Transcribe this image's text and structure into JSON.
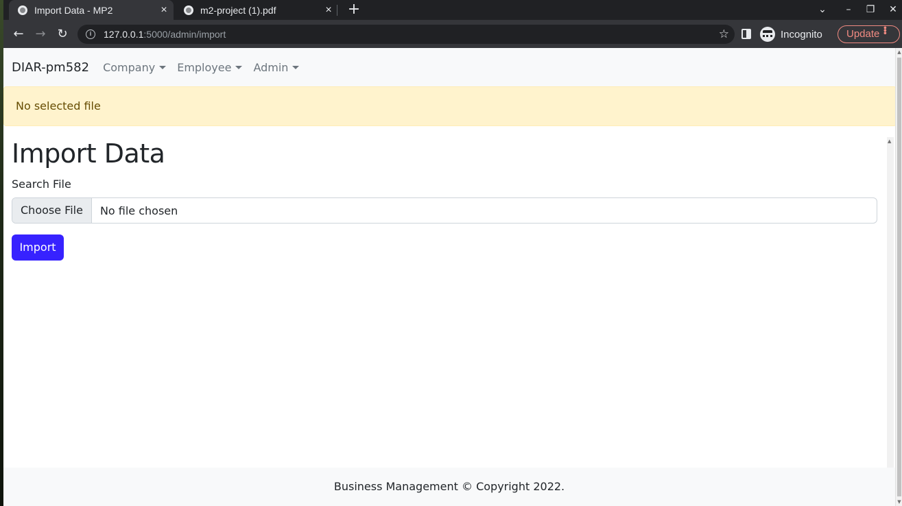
{
  "browser": {
    "tabs": [
      {
        "title": "Import Data - MP2",
        "active": true
      },
      {
        "title": "m2-project (1).pdf",
        "active": false
      }
    ],
    "url_host": "127.0.0.1",
    "url_rest": ":5000/admin/import",
    "incognito_label": "Incognito",
    "update_label": "Update"
  },
  "navbar": {
    "brand": "DIAR-pm582",
    "items": [
      {
        "label": "Company"
      },
      {
        "label": "Employee"
      },
      {
        "label": "Admin"
      }
    ]
  },
  "alert": {
    "message": "No selected file"
  },
  "main": {
    "title": "Import Data",
    "field_label": "Search File",
    "file_button": "Choose File",
    "file_status": "No file chosen",
    "import_label": "Import"
  },
  "footer": {
    "text": "Business Management © Copyright 2022."
  },
  "colors": {
    "primary_button": "#3722ff",
    "alert_bg": "#fff3cd",
    "alert_text": "#664d03",
    "update_accent": "#f28b82"
  }
}
